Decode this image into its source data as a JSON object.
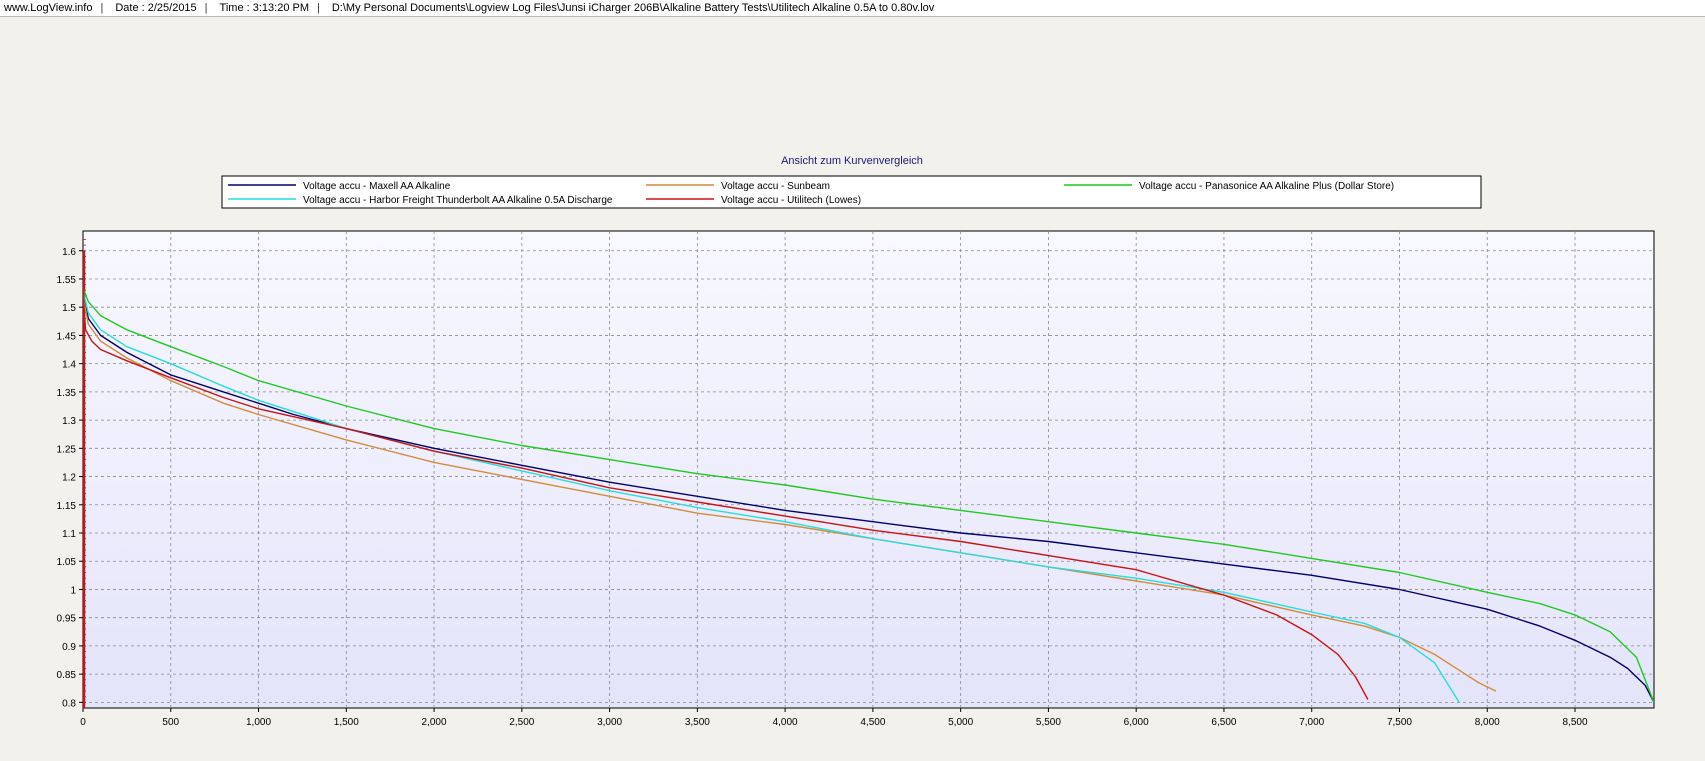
{
  "header": {
    "site": "www.LogView.info",
    "date": "Date : 2/25/2015",
    "time": "Time : 3:13:20 PM",
    "path": "D:\\My Personal Documents\\Logview Log Files\\Junsi iCharger 206B\\Alkaline Battery Tests\\Utilitech Alkaline 0.5A to 0.80v.lov",
    "separator": "|"
  },
  "colors": {
    "background": "#f3f1ec",
    "plot_bg_top": "#f8f8ff",
    "plot_bg_bottom": "#e4e4fa",
    "grid": "#8a8a8a",
    "title": "#1a1a7a"
  },
  "chart_data": {
    "type": "line",
    "title": "Ansicht zum Kurvenvergleich",
    "xlabel": "",
    "ylabel": "",
    "xlim": [
      0,
      8950
    ],
    "ylim": [
      0.79,
      1.635
    ],
    "grid": true,
    "legend_position": "top",
    "x_ticks": [
      0,
      500,
      1000,
      1500,
      2000,
      2500,
      3000,
      3500,
      4000,
      4500,
      5000,
      5500,
      6000,
      6500,
      7000,
      7500,
      8000,
      8500
    ],
    "x_tick_labels": [
      "0",
      "500",
      "1,000",
      "1,500",
      "2,000",
      "2,500",
      "3,000",
      "3,500",
      "4,000",
      "4,500",
      "5,000",
      "5,500",
      "6,000",
      "6,500",
      "7,000",
      "7,500",
      "8,000",
      "8,500"
    ],
    "y_ticks": [
      0.8,
      0.85,
      0.9,
      0.95,
      1.0,
      1.05,
      1.1,
      1.15,
      1.2,
      1.25,
      1.3,
      1.35,
      1.4,
      1.45,
      1.5,
      1.55,
      1.6
    ],
    "y_tick_labels": [
      "0.8",
      "0.85",
      "0.9",
      "0.95",
      "1",
      "1.05",
      "1.1",
      "1.15",
      "1.2",
      "1.25",
      "1.3",
      "1.35",
      "1.4",
      "1.45",
      "1.5",
      "1.55",
      "1.6"
    ],
    "series": [
      {
        "name": "Voltage accu - Maxell AA Alkaline",
        "color": "#00006e",
        "x": [
          0,
          30,
          100,
          250,
          500,
          800,
          1000,
          1200,
          1500,
          2000,
          2500,
          3000,
          3500,
          4000,
          4500,
          5000,
          5500,
          6000,
          6500,
          7000,
          7500,
          8000,
          8300,
          8500,
          8700,
          8800,
          8900,
          8950
        ],
        "y": [
          1.53,
          1.48,
          1.45,
          1.42,
          1.38,
          1.35,
          1.33,
          1.31,
          1.285,
          1.25,
          1.22,
          1.19,
          1.165,
          1.14,
          1.12,
          1.1,
          1.085,
          1.065,
          1.045,
          1.025,
          1.0,
          0.965,
          0.935,
          0.91,
          0.88,
          0.86,
          0.83,
          0.8
        ]
      },
      {
        "name": "Voltage accu - Sunbeam",
        "color": "#d28c3c",
        "x": [
          0,
          30,
          100,
          250,
          500,
          800,
          1000,
          1500,
          2000,
          2500,
          3000,
          3500,
          4000,
          4500,
          5000,
          5500,
          6000,
          6500,
          7000,
          7300,
          7500,
          7700,
          7850,
          7950,
          8050
        ],
        "y": [
          1.52,
          1.47,
          1.44,
          1.41,
          1.37,
          1.33,
          1.31,
          1.265,
          1.225,
          1.195,
          1.165,
          1.135,
          1.115,
          1.09,
          1.065,
          1.04,
          1.015,
          0.99,
          0.955,
          0.935,
          0.915,
          0.885,
          0.855,
          0.835,
          0.82
        ]
      },
      {
        "name": "Voltage accu - Panasonice AA Alkaline Plus (Dollar Store)",
        "color": "#22c822",
        "x": [
          0,
          30,
          100,
          250,
          500,
          800,
          1000,
          1500,
          2000,
          2500,
          3000,
          3500,
          4000,
          4500,
          5000,
          5500,
          6000,
          6500,
          7000,
          7500,
          8000,
          8300,
          8500,
          8700,
          8850,
          8950
        ],
        "y": [
          1.535,
          1.51,
          1.485,
          1.46,
          1.43,
          1.395,
          1.37,
          1.325,
          1.285,
          1.255,
          1.23,
          1.205,
          1.185,
          1.16,
          1.14,
          1.12,
          1.1,
          1.08,
          1.055,
          1.03,
          0.995,
          0.975,
          0.955,
          0.925,
          0.88,
          0.8
        ]
      },
      {
        "name": "Voltage accu - Harbor Freight Thunderbolt AA Alkaline 0.5A Discharge",
        "color": "#28dcdc",
        "x": [
          0,
          30,
          100,
          250,
          500,
          800,
          1000,
          1500,
          2000,
          2500,
          3000,
          3500,
          4000,
          4500,
          5000,
          5500,
          6000,
          6500,
          7000,
          7300,
          7500,
          7700,
          7780,
          7840
        ],
        "y": [
          1.53,
          1.49,
          1.46,
          1.43,
          1.4,
          1.36,
          1.335,
          1.285,
          1.245,
          1.21,
          1.175,
          1.145,
          1.12,
          1.09,
          1.065,
          1.04,
          1.02,
          0.995,
          0.96,
          0.94,
          0.915,
          0.87,
          0.83,
          0.8
        ]
      },
      {
        "name": "Voltage accu - Utilitech (Lowes)",
        "color": "#c81414",
        "x": [
          0,
          5,
          15,
          50,
          100,
          250,
          500,
          800,
          1000,
          1500,
          2000,
          2500,
          3000,
          3500,
          4000,
          4500,
          5000,
          5500,
          6000,
          6500,
          6800,
          7000,
          7150,
          7250,
          7320
        ],
        "y": [
          1.6,
          1.5,
          1.46,
          1.44,
          1.425,
          1.405,
          1.375,
          1.34,
          1.32,
          1.285,
          1.245,
          1.215,
          1.18,
          1.155,
          1.13,
          1.105,
          1.085,
          1.06,
          1.035,
          0.99,
          0.955,
          0.92,
          0.885,
          0.845,
          0.805
        ]
      }
    ]
  }
}
